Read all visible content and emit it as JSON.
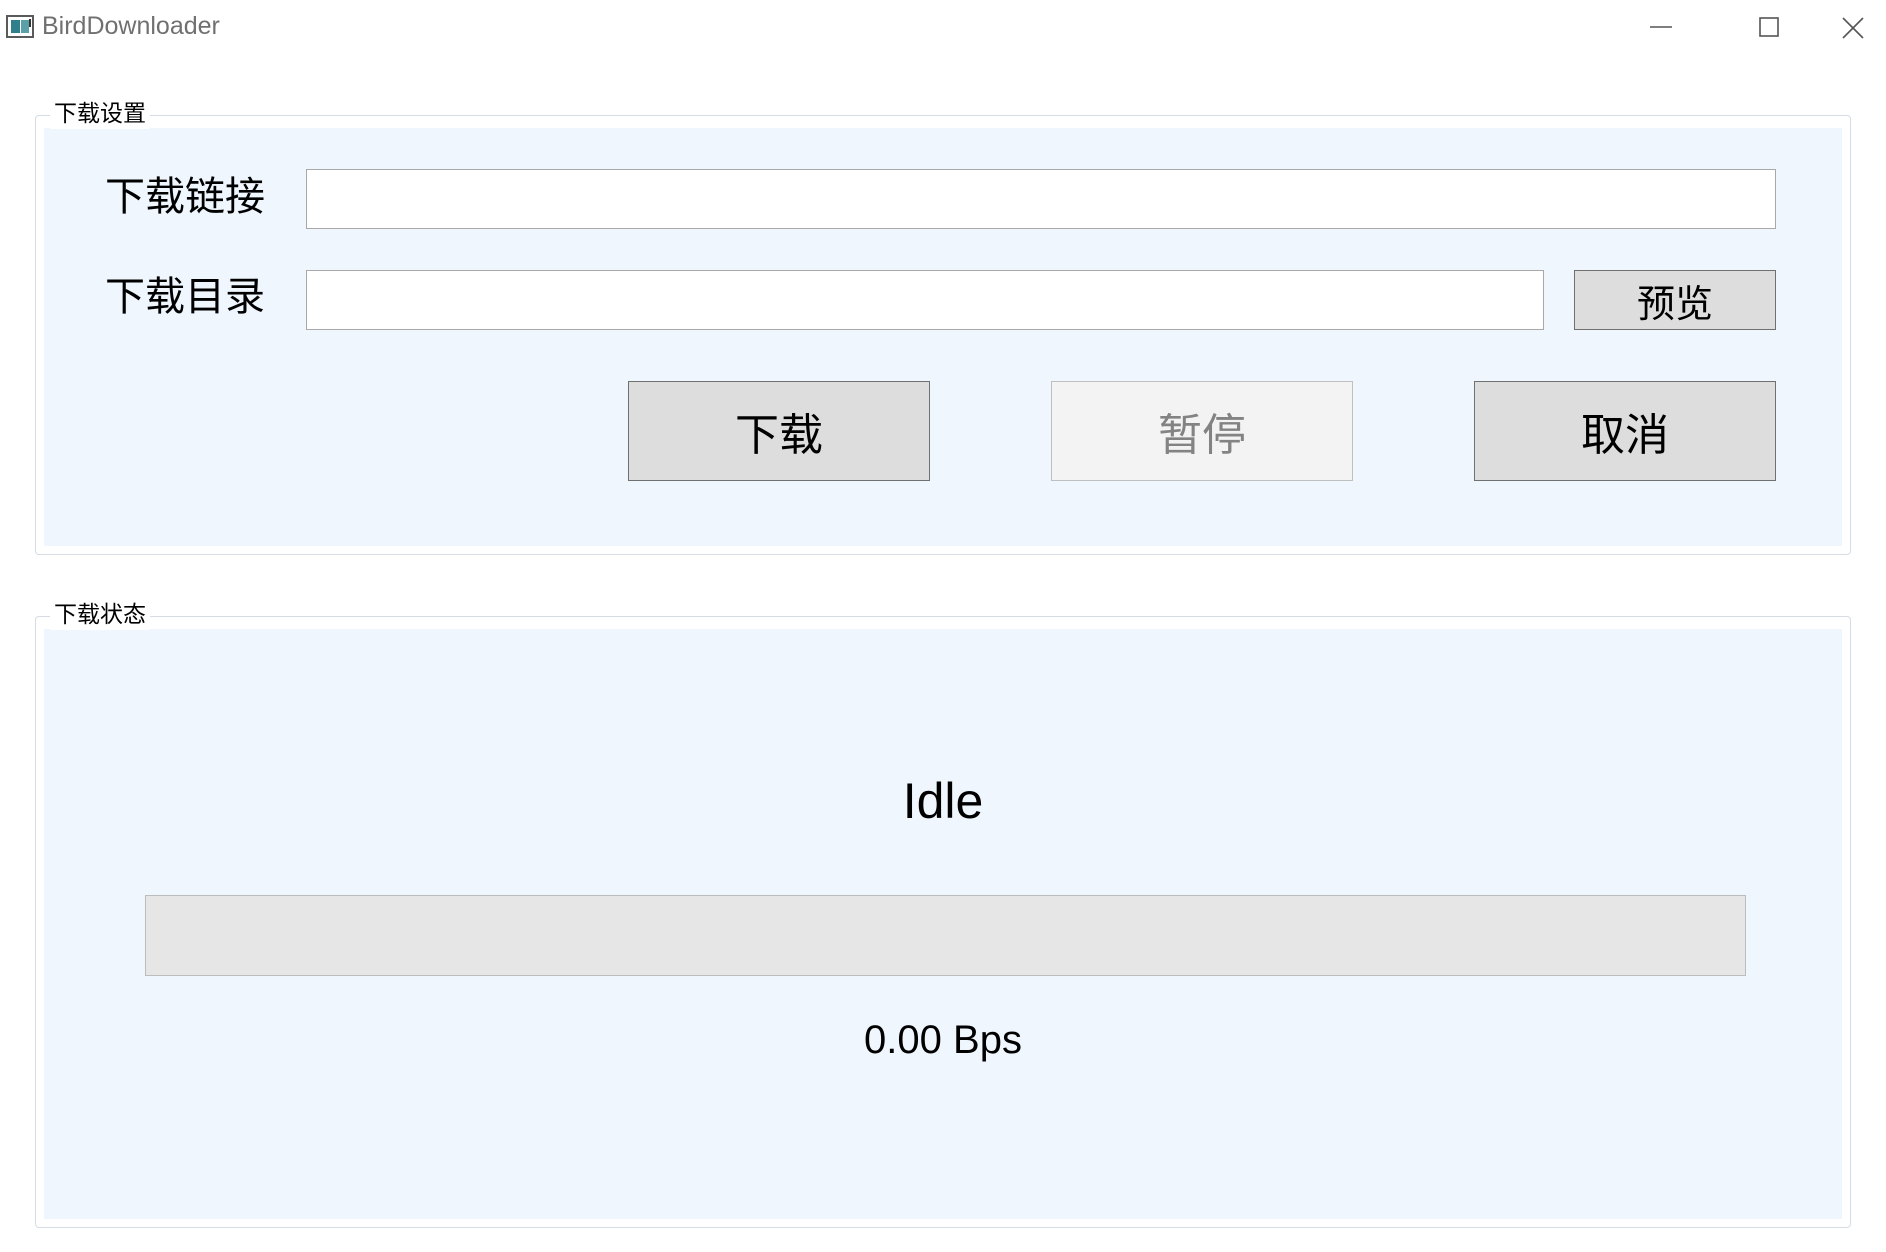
{
  "window": {
    "title": "BirdDownloader",
    "app_icon": "app-window-icon",
    "controls": {
      "minimize_icon": "minimize-icon",
      "maximize_icon": "maximize-icon",
      "close_icon": "close-icon"
    }
  },
  "settings": {
    "group_title": "下载设置",
    "url_label": "下载链接",
    "url_value": "",
    "dir_label": "下载目录",
    "dir_value": "",
    "browse_label": "预览",
    "download_label": "下载",
    "pause_label": "暂停",
    "pause_enabled": false,
    "cancel_label": "取消"
  },
  "status": {
    "group_title": "下载状态",
    "state": "Idle",
    "progress": 0,
    "speed": "0.00 Bps"
  },
  "colors": {
    "panel_background": "#eff6fd",
    "button_background": "#dddddd",
    "disabled_button_background": "#f3f3f3",
    "progress_track": "#e6e6e6"
  }
}
